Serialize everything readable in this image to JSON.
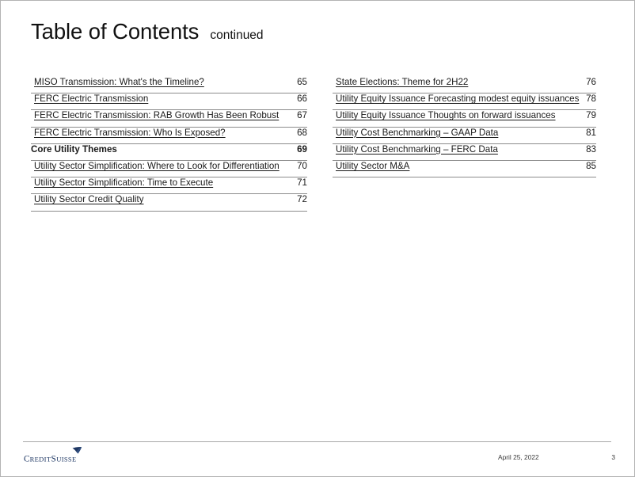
{
  "slide": {
    "title": "Table of Contents",
    "title_suffix": "continued"
  },
  "toc": {
    "left_column": [
      {
        "title": "MISO Transmission: What's the Timeline?",
        "page": "65",
        "level": "sub"
      },
      {
        "title": "FERC Electric Transmission",
        "page": "66",
        "level": "sub"
      },
      {
        "title": "FERC Electric Transmission: RAB Growth Has Been Robust",
        "page": "67",
        "level": "sub"
      },
      {
        "title": "FERC Electric Transmission: Who Is Exposed?",
        "page": "68",
        "level": "sub"
      },
      {
        "title": "Core Utility Themes",
        "page": "69",
        "level": "head"
      },
      {
        "title": "Utility Sector Simplification: Where to Look for Differentiation",
        "page": "70",
        "level": "sub"
      },
      {
        "title": "Utility Sector Simplification: Time to Execute",
        "page": "71",
        "level": "sub"
      },
      {
        "title": "Utility Sector Credit Quality",
        "page": "72",
        "level": "sub"
      }
    ],
    "right_column": [
      {
        "title": "State Elections: Theme for 2H22",
        "page": "76",
        "level": "sub"
      },
      {
        "title": "Utility Equity Issuance Forecasting modest equity issuances",
        "page": "78",
        "level": "sub"
      },
      {
        "title": "Utility Equity Issuance Thoughts on forward issuances",
        "page": "79",
        "level": "sub"
      },
      {
        "title": "Utility Cost Benchmarking – GAAP Data",
        "page": "81",
        "level": "sub"
      },
      {
        "title": "Utility Cost Benchmarking – FERC Data",
        "page": "83",
        "level": "sub"
      },
      {
        "title": "Utility Sector M&A",
        "page": "85",
        "level": "sub"
      }
    ]
  },
  "footer": {
    "logo_text": "CREDIT SUISSE",
    "logo_icon": "credit-suisse-sail-icon",
    "date": "April 25, 2022",
    "page_number": "3"
  },
  "colors": {
    "brand_navy": "#1f3864",
    "text": "#1a1a1a",
    "rule": "#8c8c8c",
    "footer_rule": "#a9a9a9"
  }
}
